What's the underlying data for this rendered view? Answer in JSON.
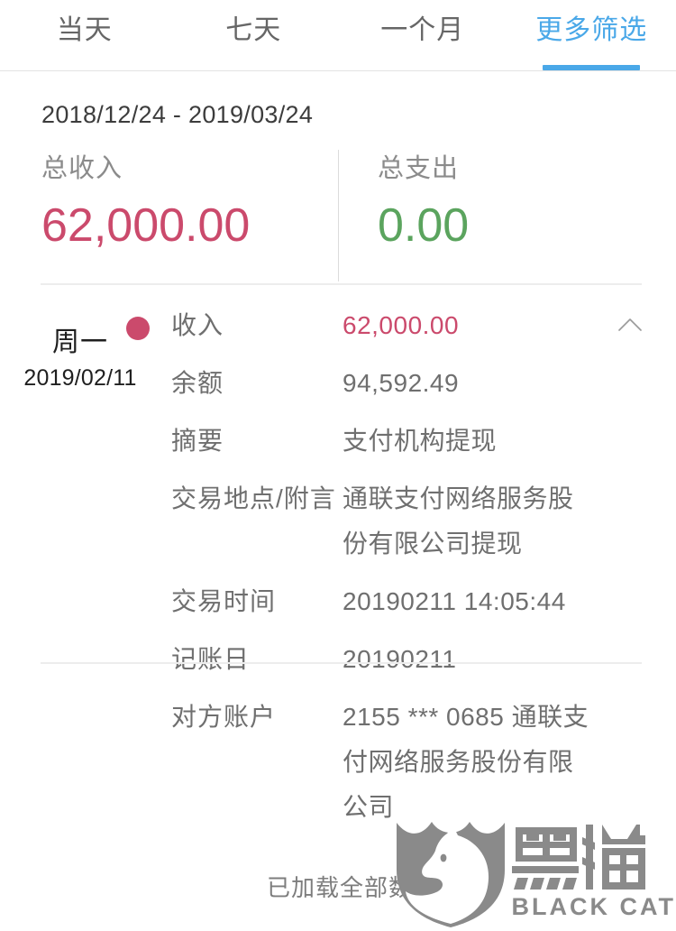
{
  "colors": {
    "accent_blue": "#4aa8e8",
    "income_red": "#cb4a6c",
    "expense_green": "#5ba45e",
    "label_gray": "#6f6f6f",
    "brand_gray": "#8a8a8a"
  },
  "tabs": [
    {
      "label": "当天",
      "active": false
    },
    {
      "label": "七天",
      "active": false
    },
    {
      "label": "一个月",
      "active": false
    },
    {
      "label": "更多筛选",
      "active": true
    }
  ],
  "date_range": "2018/12/24 - 2019/03/24",
  "summary": {
    "income": {
      "label": "总收入",
      "value": "62,000.00"
    },
    "expense": {
      "label": "总支出",
      "value": "0.00"
    }
  },
  "transaction": {
    "weekday": "周一",
    "date": "2019/02/11",
    "collapse_icon": "chevron-up-icon",
    "marker_icon": "income-dot-icon",
    "rows": [
      {
        "label": "收入",
        "value": "62,000.00",
        "is_amount": true
      },
      {
        "label": "余额",
        "value": "94,592.49",
        "is_amount": false
      },
      {
        "label": "摘要",
        "value": "支付机构提现",
        "is_amount": false
      },
      {
        "label": "交易地点/附言",
        "value": "通联支付网络服务股份有限公司提现",
        "is_amount": false
      },
      {
        "label": "交易时间",
        "value": "20190211 14:05:44",
        "is_amount": false
      },
      {
        "label": "记账日",
        "value": "20190211",
        "is_amount": false
      },
      {
        "label": "对方账户",
        "value": "2155 *** 0685 通联支付网络服务股份有限公司",
        "is_amount": false
      }
    ]
  },
  "footer": {
    "loaded_text": "已加载全部数据",
    "brand_cn": "黑猫",
    "brand_en": "BLACK CAT",
    "brand_icon": "black-cat-shield-icon"
  }
}
